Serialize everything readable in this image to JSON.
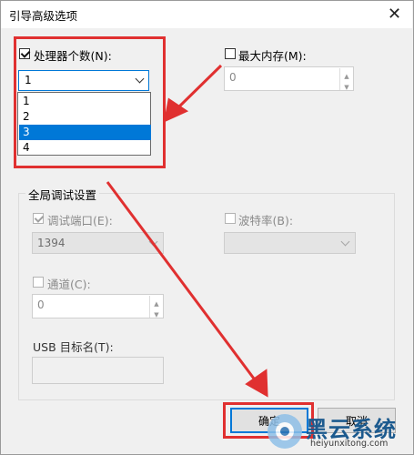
{
  "window": {
    "title": "引导高级选项",
    "close_glyph": "✕"
  },
  "processor": {
    "label": "处理器个数(N):",
    "checked": true,
    "selected_value": "1",
    "options": [
      "1",
      "2",
      "3",
      "4"
    ],
    "highlighted": "3"
  },
  "max_memory": {
    "label": "最大内存(M):",
    "checked": false,
    "value": "0"
  },
  "debug": {
    "group_title": "全局调试设置",
    "port": {
      "label": "调试端口(E):",
      "checked": true,
      "value": "1394"
    },
    "baud": {
      "label": "波特率(B):",
      "checked": false,
      "value": ""
    },
    "channel": {
      "label": "通道(C):",
      "checked": false,
      "value": "0"
    },
    "usb": {
      "label": "USB 目标名(T):",
      "value": ""
    }
  },
  "buttons": {
    "ok": "确定",
    "cancel": "取消"
  },
  "watermark": {
    "brand": "黑云系统",
    "url": "heiyunxitong.com"
  },
  "colors": {
    "accent": "#0078d7",
    "annotation_red": "#e03030"
  }
}
